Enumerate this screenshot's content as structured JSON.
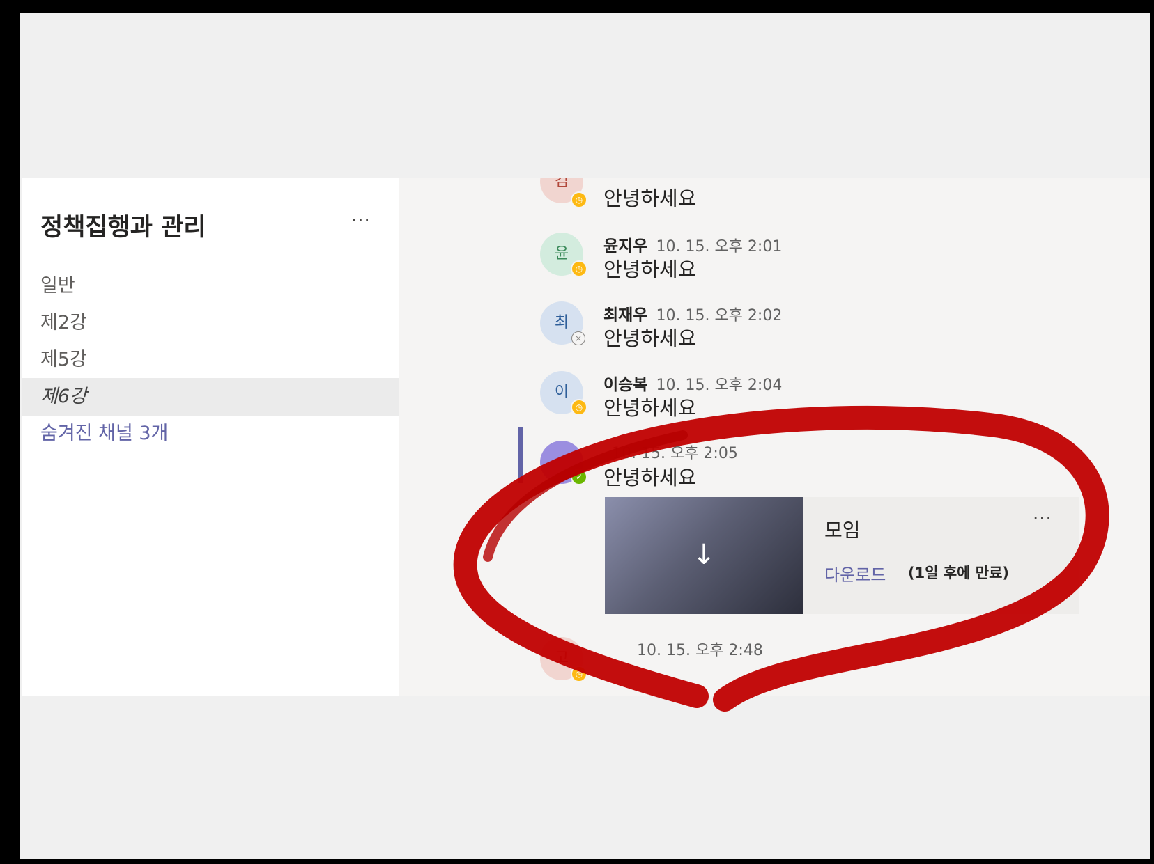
{
  "sidebar": {
    "team_name": "정책집행과 관리",
    "more": "···",
    "channels": [
      {
        "label": "일반"
      },
      {
        "label": "제2강"
      },
      {
        "label": "제5강"
      },
      {
        "label": "제6강",
        "selected": true
      },
      {
        "label": "숨겨진 채널 3개",
        "link": true
      }
    ]
  },
  "messages": [
    {
      "initial": "김",
      "author": "",
      "time": "",
      "text": "안녕하세요",
      "presence": "away"
    },
    {
      "initial": "윤",
      "author": "윤지우",
      "time": "10. 15. 오후 2:01",
      "text": "안녕하세요",
      "presence": "away"
    },
    {
      "initial": "최",
      "author": "최재우",
      "time": "10. 15. 오후 2:02",
      "text": "안녕하세요",
      "presence": "offline"
    },
    {
      "initial": "이",
      "author": "이승복",
      "time": "10. 15. 오후 2:04",
      "text": "안녕하세요",
      "presence": "away"
    },
    {
      "initial": "",
      "author": "",
      "time": "10. 15. 오후 2:05",
      "text": "안녕하세요",
      "presence": "available"
    },
    {
      "initial": "고",
      "author": "",
      "time": "10. 15. 오후 2:48",
      "text": "",
      "presence": "away"
    }
  ],
  "card": {
    "title": "모임",
    "more": "···",
    "download_label": "다운로드",
    "expiry": "(1일 후에 만료)",
    "download_icon": "↓"
  },
  "colors": {
    "accent": "#6264a7",
    "annotation": "#c00000",
    "away": "#fdb913",
    "available": "#6bb700"
  }
}
